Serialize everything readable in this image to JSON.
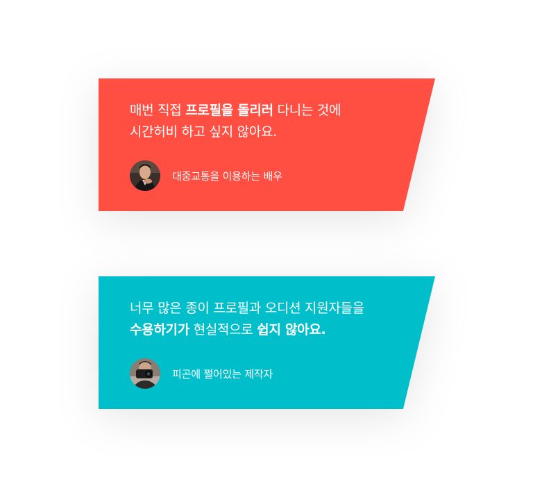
{
  "colors": {
    "card1_bg": "#ff4f42",
    "card2_bg": "#00bfca",
    "text": "#ffffff"
  },
  "testimonials": [
    {
      "quote": {
        "line1_a": "매번 직접 ",
        "line1_b": "프로필을 돌리러",
        "line1_c": " 다니는 것에",
        "line2": "시간허비 하고 싶지 않아요."
      },
      "author": "대중교통을 이용하는 배우",
      "avatar_icon": "actor-portrait-avatar"
    },
    {
      "quote": {
        "line1": "너무 많은 종이 프로필과 오디션 지원자들을",
        "line2_a": "수용하기가",
        "line2_b": " 현실적으로 ",
        "line2_c": "쉽지 않아요."
      },
      "author": "피곤에 쩔어있는 제작자",
      "avatar_icon": "producer-camera-avatar"
    }
  ]
}
